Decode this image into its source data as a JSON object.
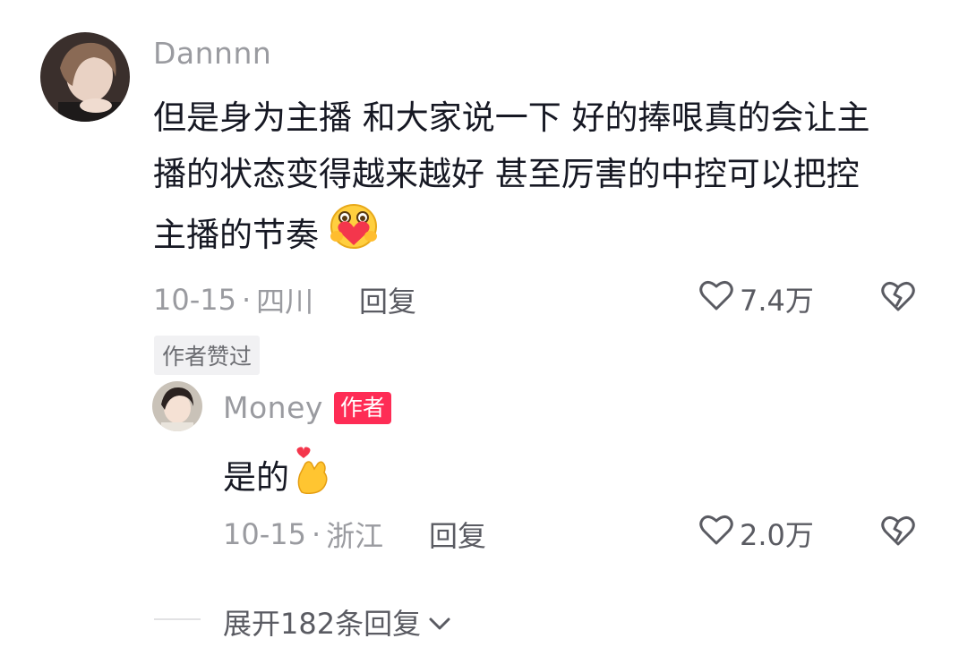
{
  "comment": {
    "username": "Dannnn",
    "text_line1": "但是身为主播 和大家说一下 好的捧哏真的会让主",
    "text_line2": "播的状态变得越来越好 甚至厉害的中控可以把控",
    "text_line3": "主播的节奏",
    "date": "10-15",
    "location": "四川",
    "reply_label": "回复",
    "likes": "7.4万",
    "author_liked_badge": "作者赞过"
  },
  "reply": {
    "username": "Money",
    "author_badge": "作者",
    "text": "是的",
    "date": "10-15",
    "location": "浙江",
    "reply_label": "回复",
    "likes": "2.0万"
  },
  "expand": {
    "label": "展开182条回复"
  },
  "colors": {
    "accent": "#fe2c55",
    "muted_text": "#9a9ba0"
  },
  "icons": [
    "heart-outline-icon",
    "broken-heart-icon",
    "chevron-down-icon",
    "hugging-heart-emoji",
    "finger-heart-emoji"
  ]
}
